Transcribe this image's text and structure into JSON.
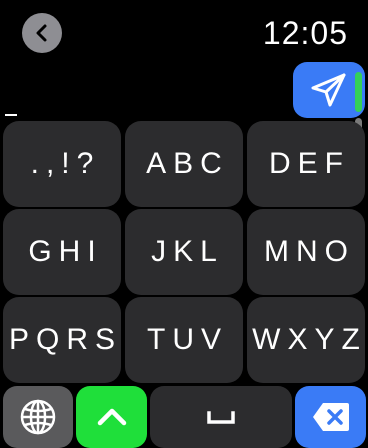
{
  "header": {
    "back_icon": "chevron-left-icon",
    "time": "12:05"
  },
  "send": {
    "icon": "paper-plane-icon",
    "color": "#3a7bf6"
  },
  "input": {
    "value": "_"
  },
  "keypad": {
    "rows": [
      [
        ".,!?",
        "ABC",
        "DEF"
      ],
      [
        "GHI",
        "JKL",
        "MNO"
      ],
      [
        "PQRS",
        "TUV",
        "WXYZ"
      ]
    ],
    "key_color": "#2c2c2e"
  },
  "bottom_row": {
    "globe_icon": "globe-icon",
    "shift_icon": "chevron-up-icon",
    "shift_color": "#1fdf3a",
    "space_icon": "space-icon",
    "delete_icon": "delete-x-icon",
    "delete_color": "#3a7bf6"
  }
}
